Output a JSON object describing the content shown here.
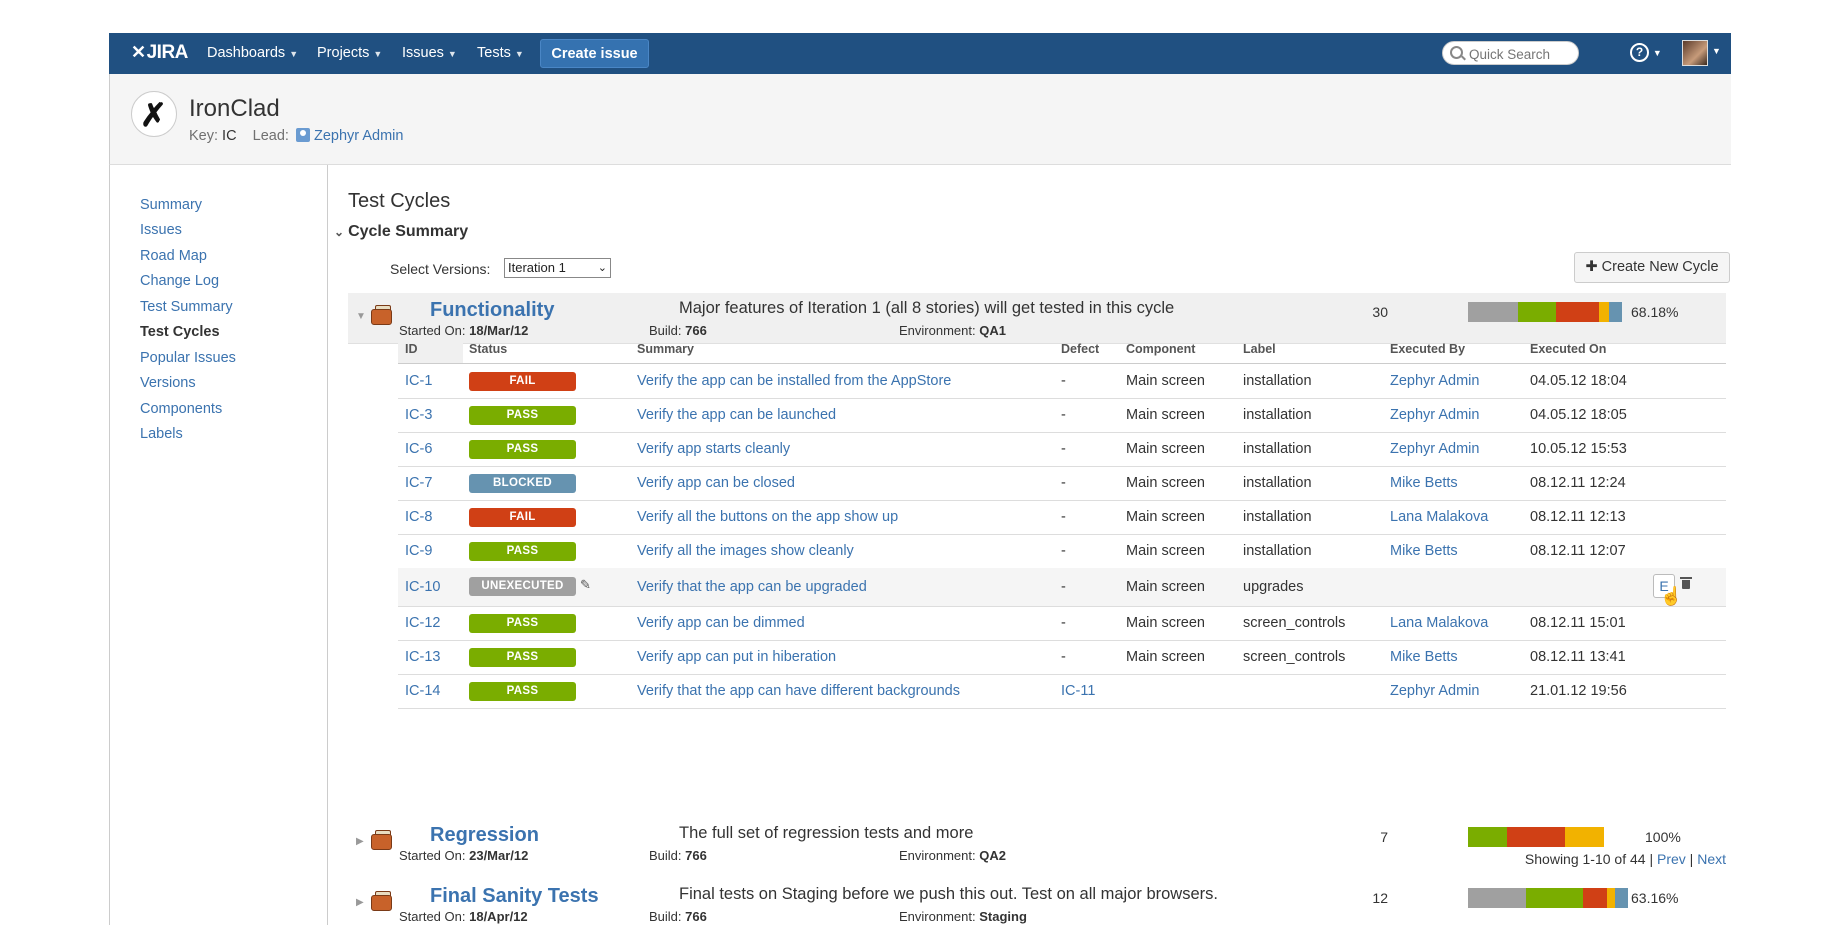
{
  "topbar": {
    "logo": "JIRA",
    "nav": [
      {
        "label": "Dashboards"
      },
      {
        "label": "Projects"
      },
      {
        "label": "Issues"
      },
      {
        "label": "Tests"
      }
    ],
    "create_label": "Create issue",
    "search_placeholder": "Quick Search",
    "help_label": "?"
  },
  "project": {
    "name": "IronClad",
    "key_label": "Key:",
    "key": "IC",
    "lead_label": "Lead:",
    "lead": "Zephyr Admin"
  },
  "sidebar": {
    "items": [
      {
        "label": "Summary"
      },
      {
        "label": "Issues"
      },
      {
        "label": "Road Map"
      },
      {
        "label": "Change Log"
      },
      {
        "label": "Test Summary"
      },
      {
        "label": "Test Cycles"
      },
      {
        "label": "Popular Issues"
      },
      {
        "label": "Versions"
      },
      {
        "label": "Components"
      },
      {
        "label": "Labels"
      }
    ],
    "active": "Test Cycles"
  },
  "main": {
    "title": "Test Cycles",
    "section": "Cycle Summary",
    "select_label": "Select Versions:",
    "select_value": "Iteration 1",
    "new_cycle_label": "Create New Cycle",
    "started_label": "Started On:",
    "build_label": "Build:",
    "env_label": "Environment:"
  },
  "colors": {
    "pass": "#7aad00",
    "fail": "#d04015",
    "blocked": "#6693b0",
    "unexecuted": "#a0a0a0",
    "wip": "#f2b200"
  },
  "cycles": [
    {
      "name": "Functionality",
      "description": "Major features of Iteration 1 (all 8 stories) will get tested in this cycle",
      "started_on": "18/Mar/12",
      "build": "766",
      "environment": "QA1",
      "count": "30",
      "percent": "68.18%",
      "progress": [
        {
          "status": "unexecuted",
          "fraction": 0.31
        },
        {
          "status": "pass",
          "fraction": 0.24
        },
        {
          "status": "fail",
          "fraction": 0.27
        },
        {
          "status": "wip",
          "fraction": 0.06
        },
        {
          "status": "blocked",
          "fraction": 0.08
        }
      ]
    },
    {
      "name": "Regression",
      "description": "The full set of regression tests and more",
      "started_on": "23/Mar/12",
      "build": "766",
      "environment": "QA2",
      "count": "7",
      "percent": "100%",
      "progress": [
        {
          "status": "pass",
          "fraction": 0.29
        },
        {
          "status": "fail",
          "fraction": 0.42
        },
        {
          "status": "wip",
          "fraction": 0.29
        }
      ]
    },
    {
      "name": "Final Sanity Tests",
      "description": "Final tests on Staging before we push this out. Test on all major browsers.",
      "started_on": "18/Apr/12",
      "build": "766",
      "environment": "Staging",
      "count": "12",
      "percent": "63.16%",
      "progress": [
        {
          "status": "unexecuted",
          "fraction": 0.36
        },
        {
          "status": "pass",
          "fraction": 0.36
        },
        {
          "status": "fail",
          "fraction": 0.15
        },
        {
          "status": "wip",
          "fraction": 0.05
        },
        {
          "status": "blocked",
          "fraction": 0.08
        }
      ]
    }
  ],
  "table": {
    "headers": [
      "ID",
      "Status",
      "Summary",
      "Defect",
      "Component",
      "Label",
      "Executed By",
      "Executed On"
    ],
    "rows": [
      {
        "id": "IC-1",
        "status": "FAIL",
        "status_key": "fail",
        "summary": "Verify the app can be installed from the AppStore",
        "defect": "-",
        "component": "Main screen",
        "label": "installation",
        "executed_by": "Zephyr Admin",
        "executed_on": "04.05.12 18:04"
      },
      {
        "id": "IC-3",
        "status": "PASS",
        "status_key": "pass",
        "summary": "Verify the app can be launched",
        "defect": "-",
        "component": "Main screen",
        "label": "installation",
        "executed_by": "Zephyr Admin",
        "executed_on": "04.05.12 18:05"
      },
      {
        "id": "IC-6",
        "status": "PASS",
        "status_key": "pass",
        "summary": "Verify app starts cleanly",
        "defect": "-",
        "component": "Main screen",
        "label": "installation",
        "executed_by": "Zephyr Admin",
        "executed_on": "10.05.12 15:53"
      },
      {
        "id": "IC-7",
        "status": "BLOCKED",
        "status_key": "blocked",
        "summary": "Verify app can be closed",
        "defect": "-",
        "component": "Main screen",
        "label": "installation",
        "executed_by": "Mike Betts",
        "executed_on": "08.12.11 12:24"
      },
      {
        "id": "IC-8",
        "status": "FAIL",
        "status_key": "fail",
        "summary": "Verify all the buttons on the app show up",
        "defect": "-",
        "component": "Main screen",
        "label": "installation",
        "executed_by": "Lana Malakova",
        "executed_on": "08.12.11 12:13"
      },
      {
        "id": "IC-9",
        "status": "PASS",
        "status_key": "pass",
        "summary": "Verify all the images show cleanly",
        "defect": "-",
        "component": "Main screen",
        "label": "installation",
        "executed_by": "Mike Betts",
        "executed_on": "08.12.11 12:07"
      },
      {
        "id": "IC-10",
        "status": "UNEXECUTED",
        "status_key": "unexecuted",
        "summary": "Verify that the app can be upgraded",
        "defect": "-",
        "component": "Main screen",
        "label": "upgrades",
        "executed_by": "",
        "executed_on": "",
        "hover": true,
        "e_label": "E"
      },
      {
        "id": "IC-12",
        "status": "PASS",
        "status_key": "pass",
        "summary": "Verify app can be dimmed",
        "defect": "-",
        "component": "Main screen",
        "label": "screen_controls",
        "executed_by": "Lana Malakova",
        "executed_on": "08.12.11 15:01"
      },
      {
        "id": "IC-13",
        "status": "PASS",
        "status_key": "pass",
        "summary": "Verify app can put in hiberation",
        "defect": "-",
        "component": "Main screen",
        "label": "screen_controls",
        "executed_by": "Mike Betts",
        "executed_on": "08.12.11 13:41"
      },
      {
        "id": "IC-14",
        "status": "PASS",
        "status_key": "pass",
        "summary": "Verify that the app can have different backgrounds",
        "defect": "IC-11",
        "component": "",
        "label": "",
        "executed_by": "Zephyr Admin",
        "executed_on": "21.01.12 19:56"
      }
    ],
    "paging": {
      "text": "Showing 1-10 of 44 |",
      "prev": "Prev",
      "sep": "|",
      "next": "Next"
    }
  }
}
